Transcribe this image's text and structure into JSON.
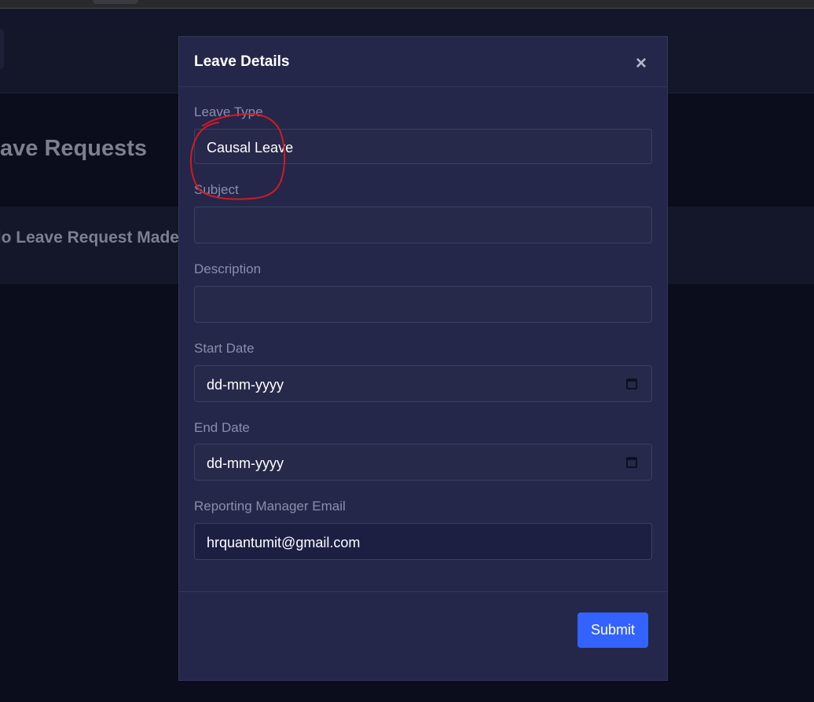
{
  "page": {
    "heading": "ave Requests",
    "empty_message": "lo Leave Request Made"
  },
  "modal": {
    "title": "Leave Details",
    "close_glyph": "×",
    "fields": {
      "leave_type": {
        "label": "Leave Type",
        "value": "Causal Leave"
      },
      "subject": {
        "label": "Subject",
        "value": ""
      },
      "description": {
        "label": "Description",
        "value": ""
      },
      "start_date": {
        "label": "Start Date",
        "placeholder": "dd-mm-yyyy"
      },
      "end_date": {
        "label": "End Date",
        "placeholder": "dd-mm-yyyy"
      },
      "manager_email": {
        "label": "Reporting Manager Email",
        "value": "hrquantumit@gmail.com"
      }
    },
    "submit_label": "Submit"
  },
  "colors": {
    "page_bg": "#0b0c1c",
    "modal_bg": "#242749",
    "submit_bg": "#3462fe",
    "annotation": "#d11a24"
  },
  "icons": [
    "close-icon",
    "calendar-icon"
  ]
}
